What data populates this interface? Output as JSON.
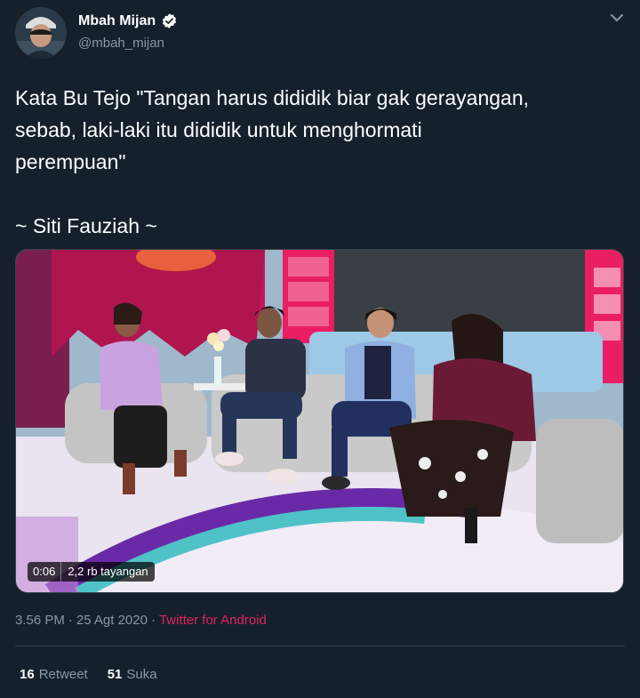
{
  "author": {
    "display_name": "Mbah Mijan",
    "handle": "@mbah_mijan",
    "verified": true,
    "avatar_icon": "profile-avatar"
  },
  "tweet": {
    "text": "Kata Bu Tejo \"Tangan harus dididik biar gak gerayangan,\nsebab, laki-laki itu dididik untuk menghormati\nperempuan\"\n\n~ Siti Fauziah ~"
  },
  "media": {
    "duration": "0:06",
    "views": "2,2 rb tayangan"
  },
  "meta": {
    "time": "3.56 PM",
    "separator1": "·",
    "date": "25 Agt 2020",
    "separator2": "·",
    "source": "Twitter for Android"
  },
  "stats": {
    "retweets_count": "16",
    "retweets_label": "Retweet",
    "likes_count": "51",
    "likes_label": "Suka"
  },
  "colors": {
    "background": "#15202b",
    "secondary_text": "#8899a6",
    "source_link": "#e0245e",
    "verified_badge": "#ffffff",
    "divider": "#38444d"
  }
}
